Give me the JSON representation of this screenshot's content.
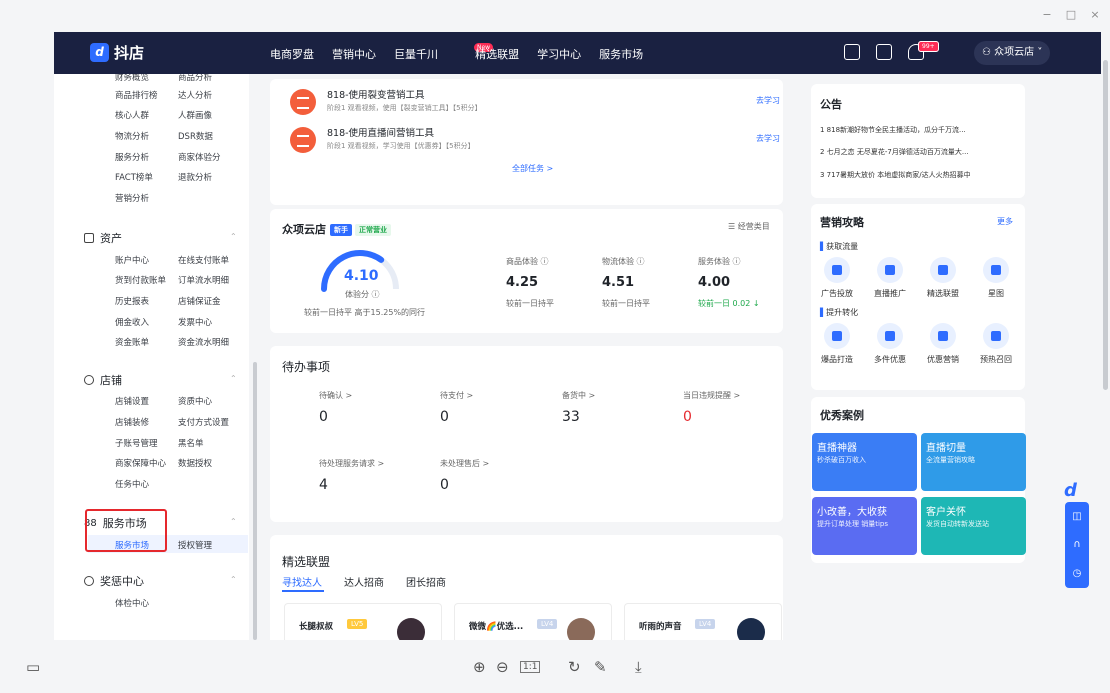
{
  "window": {
    "minimize": "−",
    "maximize": "□",
    "close": "×"
  },
  "nav": {
    "logo": "抖店",
    "logo_mark": "d",
    "menu": [
      "电商罗盘",
      "营销中心",
      "巨量千川",
      "精选联盟",
      "学习中心",
      "服务市场"
    ],
    "new_badge": "New",
    "notif_badge": "99+",
    "user": "众项云店"
  },
  "sidebar": {
    "top_items": [
      [
        "财务概览",
        "商品分析"
      ],
      [
        "商品排行榜",
        "达人分析"
      ],
      [
        "核心人群",
        "人群画像"
      ],
      [
        "物流分析",
        "DSR数据"
      ],
      [
        "服务分析",
        "商家体验分"
      ],
      [
        "FACT榜单",
        "退款分析"
      ],
      [
        "营销分析",
        ""
      ]
    ],
    "groups": [
      {
        "title": "资产",
        "items": [
          [
            "账户中心",
            "在线支付账单"
          ],
          [
            "货到付款账单",
            "订单流水明细"
          ],
          [
            "历史报表",
            "店铺保证金"
          ],
          [
            "佣金收入",
            "发票中心"
          ],
          [
            "资金账单",
            "资金流水明细"
          ]
        ]
      },
      {
        "title": "店铺",
        "items": [
          [
            "店铺设置",
            "资质中心"
          ],
          [
            "店铺装修",
            "支付方式设置"
          ],
          [
            "子账号管理",
            "黑名单"
          ],
          [
            "商家保障中心",
            "数据授权"
          ],
          [
            "任务中心",
            ""
          ]
        ]
      },
      {
        "title": "服务市场",
        "items": [
          [
            "服务市场",
            "授权管理"
          ]
        ]
      },
      {
        "title": "奖惩中心",
        "items": [
          [
            "体检中心",
            ""
          ]
        ]
      }
    ]
  },
  "tasks": {
    "items": [
      {
        "title": "818-使用裂变营销工具",
        "desc": "阶段1 观看视频，使用【裂变营销工具】【5积分】",
        "action": "去学习"
      },
      {
        "title": "818-使用直播间营销工具",
        "desc": "阶段1 观看视频，学习使用【优惠券】【5积分】",
        "action": "去学习"
      }
    ],
    "all": "全部任务 >"
  },
  "shop": {
    "name": "众项云店",
    "tag_new": "新手",
    "tag_status": "正常营业",
    "category": "经营类目",
    "score": "4.10",
    "score_label": "体验分 ⓘ",
    "score_note": "较前一日持平  高于15.25%的同行",
    "score_fraction": 0.7,
    "metrics": [
      {
        "label": "商品体验 ⓘ",
        "value": "4.25",
        "note": "较前一日持平"
      },
      {
        "label": "物流体验 ⓘ",
        "value": "4.51",
        "note": "较前一日持平"
      },
      {
        "label": "服务体验 ⓘ",
        "value": "4.00",
        "note": "较前一日 0.02 ↓"
      }
    ]
  },
  "todo": {
    "title": "待办事项",
    "items": [
      {
        "label": "待确认 >",
        "value": "0"
      },
      {
        "label": "待支付 >",
        "value": "0"
      },
      {
        "label": "备货中 >",
        "value": "33"
      },
      {
        "label": "当日违规提醒 >",
        "value": "0"
      },
      {
        "label": "待处理服务请求 >",
        "value": "4"
      },
      {
        "label": "未处理售后 >",
        "value": "0"
      }
    ]
  },
  "alliance": {
    "title": "精选联盟",
    "tabs": [
      "寻找达人",
      "达人招商",
      "团长招商"
    ],
    "cards": [
      {
        "name": "长腿叔叔",
        "level": "LV5"
      },
      {
        "name": "微微🌈优选...",
        "level": "LV4"
      },
      {
        "name": "听雨的声音",
        "level": "LV4"
      }
    ]
  },
  "notice": {
    "title": "公告",
    "items": [
      "1  818新潮好物节全民主播活动，瓜分千万流...",
      "2  七月之恋 无尽夏花-7月弹德活动百万流量大...",
      "3  717暑期大放价 本地虚拟商家/达人火热招募中"
    ]
  },
  "marketing": {
    "title": "营销攻略",
    "more": "更多",
    "sec1": "获取流量",
    "sec1_items": [
      "广告投放",
      "直播推广",
      "精选联盟",
      "星图"
    ],
    "sec2": "提升转化",
    "sec2_items": [
      "爆品打造",
      "多件优惠",
      "优惠营销",
      "预热召回"
    ]
  },
  "cases": {
    "title": "优秀案例",
    "items": [
      {
        "title": "直播神器",
        "sub": "秒杀破百万收入",
        "color": "#3a7df5"
      },
      {
        "title": "直播切量",
        "sub": "全流量营销攻略",
        "color": "#2f9be8"
      },
      {
        "title": "小改善，大收获",
        "sub": "提升订单处理 销量tips",
        "color": "#5a6cf2"
      },
      {
        "title": "客户关怀",
        "sub": "发货自动转新发送站",
        "color": "#1eb7b5"
      }
    ]
  },
  "toolbar": {
    "zoom_in": "⊕",
    "zoom_out": "⊖",
    "fit": "1:1",
    "rotate": "↻",
    "edit": "✎",
    "download": "⤓",
    "panel": "▭"
  }
}
